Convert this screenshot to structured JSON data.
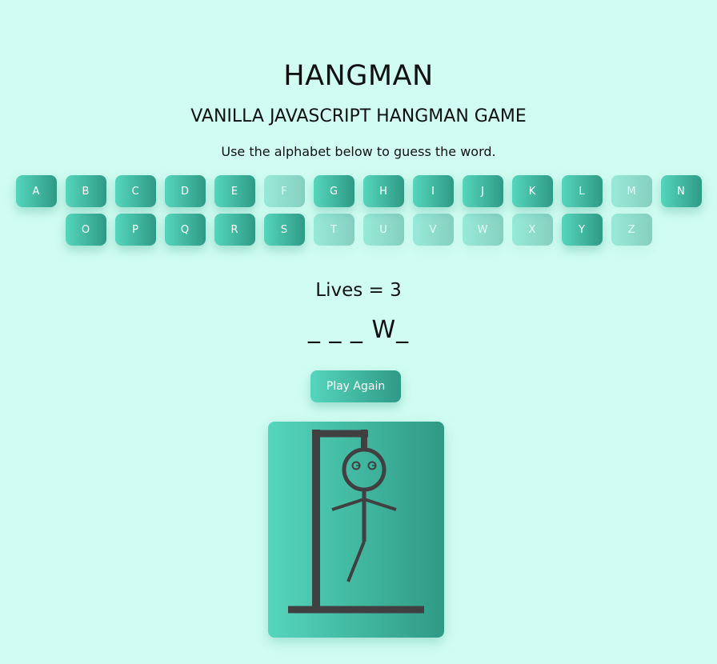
{
  "header": {
    "title": "HANGMAN",
    "subtitle": "VANILLA JAVASCRIPT HANGMAN GAME",
    "instructions": "Use the alphabet below to guess the word."
  },
  "keyboard": {
    "row1": [
      {
        "letter": "A",
        "used": false
      },
      {
        "letter": "B",
        "used": false
      },
      {
        "letter": "C",
        "used": false
      },
      {
        "letter": "D",
        "used": false
      },
      {
        "letter": "E",
        "used": false
      },
      {
        "letter": "F",
        "used": true
      },
      {
        "letter": "G",
        "used": false
      },
      {
        "letter": "H",
        "used": false
      },
      {
        "letter": "I",
        "used": false
      },
      {
        "letter": "J",
        "used": false
      },
      {
        "letter": "K",
        "used": false
      },
      {
        "letter": "L",
        "used": false
      },
      {
        "letter": "M",
        "used": true
      },
      {
        "letter": "N",
        "used": false
      }
    ],
    "row2": [
      {
        "letter": "O",
        "used": false
      },
      {
        "letter": "P",
        "used": false
      },
      {
        "letter": "Q",
        "used": false
      },
      {
        "letter": "R",
        "used": false
      },
      {
        "letter": "S",
        "used": false
      },
      {
        "letter": "T",
        "used": true
      },
      {
        "letter": "U",
        "used": true
      },
      {
        "letter": "V",
        "used": true
      },
      {
        "letter": "W",
        "used": true
      },
      {
        "letter": "X",
        "used": true
      },
      {
        "letter": "Y",
        "used": false
      },
      {
        "letter": "Z",
        "used": true
      }
    ]
  },
  "status": {
    "lives": "Lives = 3",
    "word": "_ _ _ W_"
  },
  "controls": {
    "play_again_label": "Play Again"
  },
  "drawing": {
    "parts_shown": [
      "ground",
      "pole",
      "beam",
      "rope",
      "head",
      "eyes",
      "body",
      "arms",
      "left-leg"
    ]
  },
  "colors": {
    "background": "#d0fcf1",
    "accent_start": "#55d6bc",
    "accent_end": "#2f9a86",
    "stroke": "#404040"
  }
}
